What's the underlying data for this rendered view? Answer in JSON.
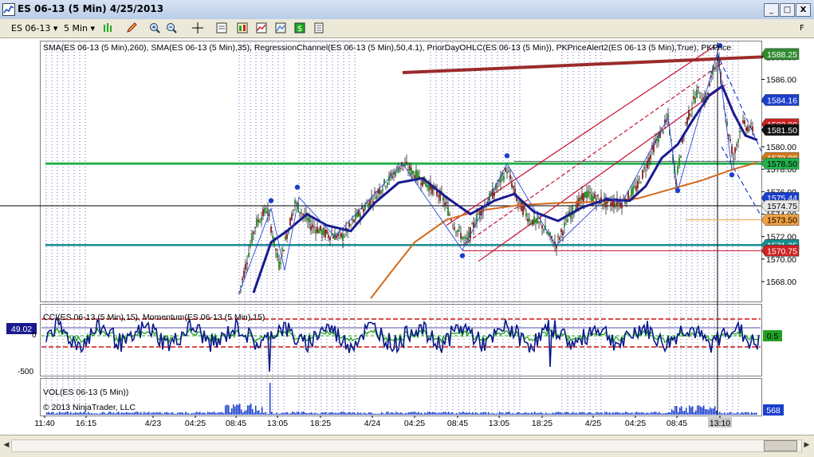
{
  "window": {
    "title": "ES 06-13 (5 Min)  4/25/2013",
    "minimize": "_",
    "maximize": "□",
    "close": "X"
  },
  "toolbar": {
    "instrument": "ES 06-13",
    "interval": "5 Min",
    "icons": [
      "bar-chart-icon",
      "pencil-icon",
      "zoom-in-icon",
      "zoom-out-icon",
      "crosshair-icon",
      "data-box-icon",
      "properties-icon",
      "indicators-icon",
      "strategies-icon",
      "order-icon",
      "templates-icon"
    ],
    "corner_label": "F"
  },
  "chart": {
    "price_indicators_label": "SMA(ES 06-13 (5 Min),260), SMA(ES 06-13 (5 Min),35), RegressionChannel(ES 06-13 (5 Min),50,4.1), PriorDayOHLC(ES 06-13 (5 Min)), PKPriceAlert2(ES 06-13 (5 Min),True), PKPrice",
    "cci_label": "CCI(ES 06-13 (5 Min),15), Momentum(ES 06-13 (5 Min),15)",
    "vol_label": "VOL(ES 06-13 (5 Min))",
    "copyright": "© 2013 NinjaTrader, LLC",
    "price_ticks": [
      "1588.00",
      "1586.00",
      "1584.00",
      "1582.00",
      "1580.00",
      "1578.00",
      "1576.00",
      "1574.00",
      "1572.00",
      "1570.00",
      "1568.00"
    ],
    "price_markers": [
      {
        "text": "1588.25",
        "bg": "#2e8b2e",
        "fg": "#ffffff"
      },
      {
        "text": "1584.16",
        "bg": "#1a3fcc",
        "fg": "#ffffff"
      },
      {
        "text": "1582.00",
        "bg": "#cc2222",
        "fg": "#ffffff"
      },
      {
        "text": "1581.50",
        "bg": "#111111",
        "fg": "#ffffff"
      },
      {
        "text": "1579.00",
        "bg": "#d27a1a",
        "fg": "#ffffff"
      },
      {
        "text": "1578.50",
        "bg": "#22b14c",
        "fg": "#000000"
      },
      {
        "text": "1575.44",
        "bg": "#1a3fcc",
        "fg": "#ffffff"
      },
      {
        "text": "1574.75",
        "bg": "#e8e8e8",
        "fg": "#000000"
      },
      {
        "text": "1573.50",
        "bg": "#f0a040",
        "fg": "#000000"
      },
      {
        "text": "1571.25",
        "bg": "#1a8f8f",
        "fg": "#ffffff"
      },
      {
        "text": "1570.75",
        "bg": "#cc2222",
        "fg": "#ffffff"
      }
    ],
    "cci_value_left": "49.02",
    "cci_value_right": "0.5",
    "cci_tick_zero": "0",
    "cci_tick_min": "-500",
    "vol_value_right": "568",
    "time_labels": [
      "11:40",
      "16:15",
      "4/23",
      "04:25",
      "08:45",
      "13:05",
      "18:25",
      "4/24",
      "04:25",
      "08:45",
      "13:05",
      "18:25",
      "4/25",
      "04:25",
      "08:45",
      "13:10"
    ],
    "colors": {
      "sma_slow": "#d2691e",
      "sma_fast": "#1a1a8f",
      "regression": "#c8102e",
      "prior_high": "#9b2b2b",
      "prior_close": "#22b14c",
      "prior_low": "#1a8f8f",
      "candle_up": "#1a8f1a",
      "candle_down": "#8b1a1a",
      "cci": "#0a1a8a",
      "momentum": "#22a022",
      "volume": "#1a3fcc"
    }
  }
}
